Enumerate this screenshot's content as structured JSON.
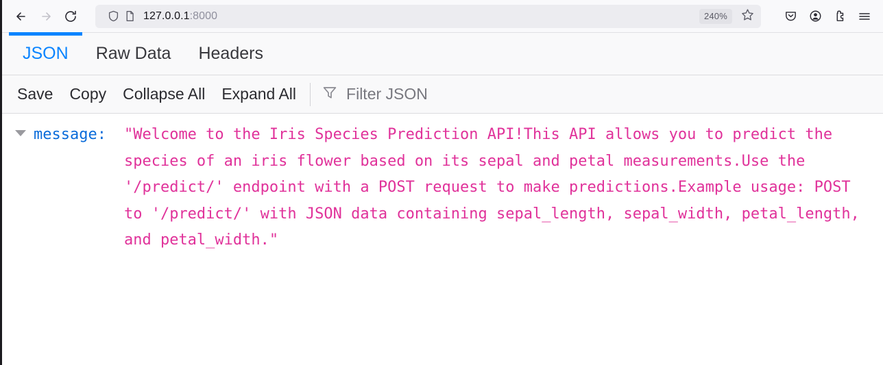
{
  "browser": {
    "back_icon": "back-arrow-icon",
    "forward_icon": "forward-arrow-icon",
    "reload_icon": "reload-icon",
    "shield_icon": "tracking-protection-shield-icon",
    "page_icon": "page-document-icon",
    "url_host": "127.0.0.1",
    "url_port": ":8000",
    "url_full": "127.0.0.1:8000",
    "zoom_level": "240%",
    "bookmark_icon": "star-icon",
    "pocket_icon": "pocket-icon",
    "account_icon": "account-circle-icon",
    "extensions_icon": "puzzle-piece-icon",
    "menu_icon": "hamburger-menu-icon",
    "accent_color": "#0a84ff"
  },
  "viewer": {
    "tabs": [
      {
        "label": "JSON",
        "active": true
      },
      {
        "label": "Raw Data",
        "active": false
      },
      {
        "label": "Headers",
        "active": false
      }
    ],
    "toolbar": {
      "save_label": "Save",
      "copy_label": "Copy",
      "collapse_all_label": "Collapse All",
      "expand_all_label": "Expand All",
      "filter_icon": "filter-funnel-icon",
      "filter_placeholder": "Filter JSON"
    },
    "colors": {
      "key": "#0b6cda",
      "string_value": "#e0329a",
      "expander": "#9a9a9f"
    },
    "json": {
      "expander_icon": "triangle-down-icon",
      "key": "message:",
      "key_name": "message",
      "value": "\"Welcome to the Iris Species Prediction API!This API allows you to predict the species of an iris flower based on its sepal and petal measurements.Use the '/predict/' endpoint with a POST request to make predictions.Example usage: POST to '/predict/' with JSON data containing sepal_length, sepal_width, petal_length, and petal_width.\""
    }
  }
}
